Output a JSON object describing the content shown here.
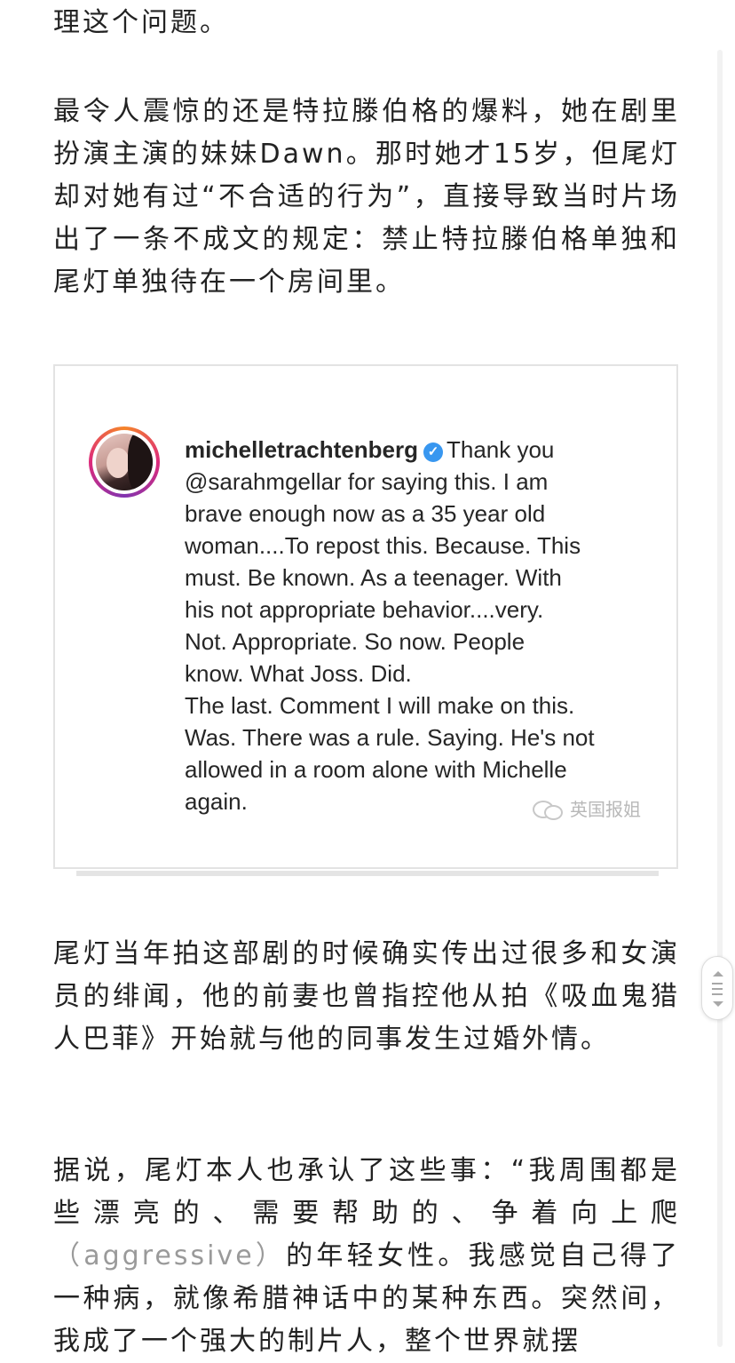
{
  "article": {
    "paragraphs": [
      "理这个问题。",
      "最令人震惊的还是特拉滕伯格的爆料，她在剧里扮演主演的妹妹Dawn。那时她才15岁，但尾灯却对她有过“不合适的行为”，直接导致当时片场出了一条不成文的规定：禁止特拉滕伯格单独和尾灯单独待在一个房间里。",
      "尾灯当年拍这部剧的时候确实传出过很多和女演员的绯闻，他的前妻也曾指控他从拍《吸血鬼猎人巴菲》开始就与他的同事发生过婚外情。"
    ],
    "last_paragraph": {
      "before": "据说，尾灯本人也承认了这些事：“我周围都是些漂亮的、需要帮助的、争着向上爬",
      "muted": "（aggressive）",
      "after": "的年轻女性。我感觉自己得了一种病，就像希腊神话中的某种东西。突然间，我成了一个强大的制片人，整个世界就摆"
    }
  },
  "embedded_post": {
    "username": "michelletrachtenberg",
    "verified_icon": "verified-badge-icon",
    "first_line_text": "Thank you",
    "lines": [
      "@sarahmgellar for saying this. I am",
      "brave enough now as a 35 year old",
      "woman....To repost this. Because. This",
      "must. Be known. As a teenager. With",
      "his not appropriate behavior....very.",
      "Not. Appropriate. So now. People",
      "know. What Joss. Did.",
      "The last. Comment I will make on this.",
      "Was. There was a rule. Saying. He's not",
      "allowed in a room alone with Michelle",
      "again."
    ],
    "watermark": "英国报姐",
    "watermark_icon": "wechat-icon"
  },
  "colors": {
    "body_text": "#222222",
    "muted_text": "#9a9a9a",
    "verified_blue": "#3897f0",
    "card_border": "#e3e3e3"
  },
  "scrollbar": {
    "handle_icon": "scroll-grip-icon"
  }
}
